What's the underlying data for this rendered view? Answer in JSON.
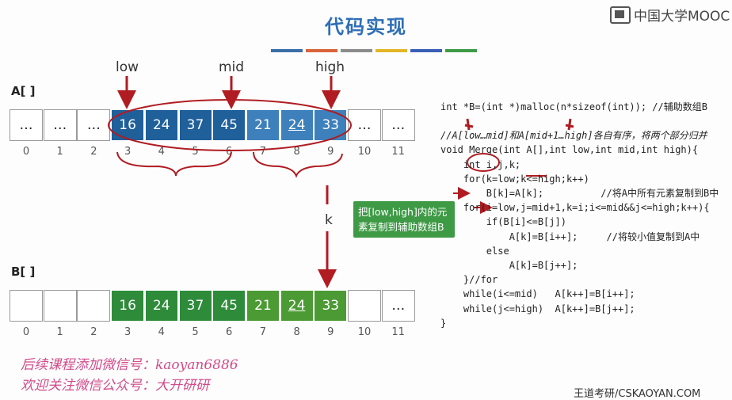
{
  "title": "代码实现",
  "logo_text": "中国大学MOOC",
  "color_bars": [
    "#3b6fa8",
    "#d9643a",
    "#8c8c8c",
    "#e3b62a",
    "#3b5fb5",
    "#3f9a46"
  ],
  "labels": {
    "low": "low",
    "mid": "mid",
    "high": "high",
    "k": "k"
  },
  "array_a": {
    "name": "A[ ]",
    "cells": [
      "…",
      "…",
      "…",
      "16",
      "24",
      "37",
      "45",
      "21",
      "24",
      "33",
      "…",
      "…"
    ],
    "indices": [
      "0",
      "1",
      "2",
      "3",
      "4",
      "5",
      "6",
      "7",
      "8",
      "9",
      "10",
      "11"
    ]
  },
  "array_b": {
    "name": "B[ ]",
    "cells": [
      "",
      "",
      "",
      "16",
      "24",
      "37",
      "45",
      "21",
      "24",
      "33",
      "",
      "…"
    ],
    "indices": [
      "0",
      "1",
      "2",
      "3",
      "4",
      "5",
      "6",
      "7",
      "8",
      "9",
      "10",
      "11"
    ]
  },
  "code": {
    "line1": "int *B=(int *)malloc(n*sizeof(int)); //辅助数组B",
    "comment1": "//A[low…mid]和A[mid+1…high]各自有序，将两个部分归并",
    "sig": "void Merge(int A[],int low,int mid,int high){",
    "decl": "    int i,j,k;",
    "for1": "    for(k=low;k<=high;k++)",
    "copy": "        B[k]=A[k];          //将A中所有元素复制到B中",
    "for2": "    for(i=low,j=mid+1,k=i;i<=mid&&j<=high;k++){",
    "if": "        if(B[i]<=B[j])",
    "assign1": "            A[k]=B[i++];     //将较小值复制到A中",
    "else": "        else",
    "assign2": "            A[k]=B[j++];",
    "endfor": "    }//for",
    "while1": "    while(i<=mid)   A[k++]=B[i++];",
    "while2": "    while(j<=high)  A[k++]=B[j++];",
    "end": "}"
  },
  "callout": "把[low,high]内的元素复制到辅助数组B",
  "footer": {
    "line1": "后续课程添加微信号：kaoyan6886",
    "line2": "欢迎关注微信公众号：大开研研"
  },
  "watermark": "王道考研/CSKAOYAN.COM"
}
